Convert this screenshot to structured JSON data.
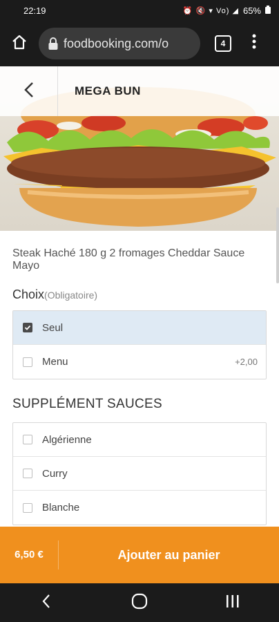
{
  "status_bar": {
    "time": "22:19",
    "icons_text": "⏰ 🔇 ▾ Vo) ◢",
    "battery": "65%"
  },
  "browser": {
    "url": "foodbooking.com/o",
    "tab_count": "4"
  },
  "product": {
    "title": "MEGA BUN",
    "description": "Steak Haché 180 g 2 fromages Cheddar Sauce Mayo"
  },
  "choix": {
    "heading": "Choix",
    "required_label": "(Obligatoire)",
    "options": [
      {
        "label": "Seul",
        "price": "",
        "checked": true
      },
      {
        "label": "Menu",
        "price": "+2,00",
        "checked": false
      }
    ]
  },
  "sauces": {
    "heading": "SUPPLÉMENT SAUCES",
    "options": [
      {
        "label": "Algérienne",
        "checked": false
      },
      {
        "label": "Curry",
        "checked": false
      },
      {
        "label": "Blanche",
        "checked": false
      }
    ]
  },
  "cart": {
    "price": "6,50 €",
    "button_label": "Ajouter au panier"
  },
  "colors": {
    "accent": "#f0901e",
    "selected_bg": "#dfeaf4",
    "dark_bar": "#1b1b1b"
  }
}
